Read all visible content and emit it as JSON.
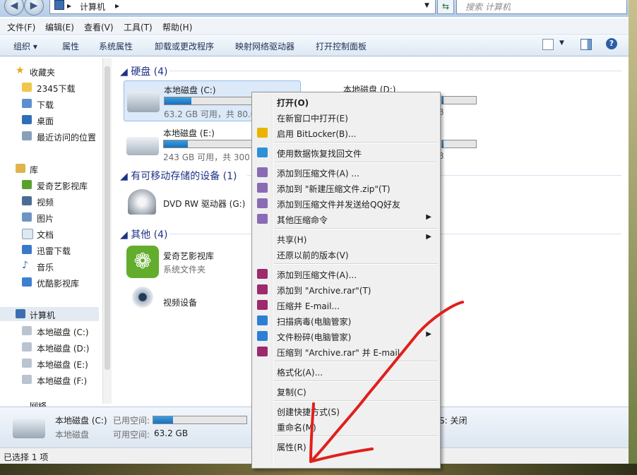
{
  "window": {
    "address": {
      "root_icon": "computer-icon",
      "path": "计算机",
      "sep": "▸"
    },
    "search_placeholder": "搜索 计算机"
  },
  "menubar": [
    "文件(F)",
    "编辑(E)",
    "查看(V)",
    "工具(T)",
    "帮助(H)"
  ],
  "toolbar": {
    "organize": "组织",
    "items": [
      "属性",
      "系统属性",
      "卸载或更改程序",
      "映射网络驱动器",
      "打开控制面板"
    ]
  },
  "nav": {
    "favorites": {
      "label": "收藏夹",
      "items": [
        "2345下载",
        "下载",
        "桌面",
        "最近访问的位置"
      ]
    },
    "libraries": {
      "label": "库",
      "items": [
        "爱奇艺影视库",
        "视频",
        "图片",
        "文档",
        "迅雷下载",
        "音乐",
        "优酷影视库"
      ]
    },
    "computer": {
      "label": "计算机",
      "items": [
        "本地磁盘 (C:)",
        "本地磁盘 (D:)",
        "本地磁盘 (E:)",
        "本地磁盘 (F:)"
      ]
    },
    "network": "网络"
  },
  "content": {
    "groups": [
      "硬盘 (4)",
      "有可移动存储的设备 (1)",
      "其他 (4)"
    ],
    "drives": [
      {
        "name": "本地磁盘 (C:)",
        "sub": "63.2 GB 可用，共 80.0",
        "used": 0.21
      },
      {
        "name": "本地磁盘 (D:)",
        "sub": "",
        "used": 0.05
      },
      {
        "name": "本地磁盘 (E:)",
        "sub": "243 GB 可用，共 300",
        "used": 0.19
      },
      {
        "name": "",
        "sub": "",
        "used": 0.04
      }
    ],
    "removable": [
      {
        "name": "DVD RW 驱动器 (G:)"
      }
    ],
    "other": [
      {
        "name": "爱奇艺影视库",
        "sub": "系统文件夹"
      },
      {
        "name": "视频设备",
        "sub": ""
      }
    ],
    "d_suffix": "3",
    "f_suffix": "3"
  },
  "details": {
    "name": "本地磁盘 (C:)",
    "type": "本地磁盘",
    "used_label": "已用空间:",
    "free_label": "可用空间:",
    "free_value": "63.2 GB",
    "used": 0.21,
    "bitlocker_suffix": "S: 关闭"
  },
  "status": "已选择 1 项",
  "context_menu": [
    {
      "label": "打开(O)",
      "bold": true,
      "icon": ""
    },
    {
      "label": "在新窗口中打开(E)",
      "icon": ""
    },
    {
      "label": "启用 BitLocker(B)...",
      "icon": "shield-icon"
    },
    {
      "sep": true
    },
    {
      "label": "使用数据恢复找回文件",
      "icon": "recovery-icon"
    },
    {
      "sep": true
    },
    {
      "label": "添加到压缩文件(A) ...",
      "icon": "zip-icon"
    },
    {
      "label": "添加到 \"新建压缩文件.zip\"(T)",
      "icon": "zip-icon"
    },
    {
      "label": "添加到压缩文件并发送给QQ好友",
      "icon": "zip-icon"
    },
    {
      "label": "其他压缩命令",
      "icon": "zip-icon",
      "arrow": true
    },
    {
      "sep": true
    },
    {
      "label": "共享(H)",
      "icon": "",
      "arrow": true
    },
    {
      "label": "还原以前的版本(V)",
      "icon": ""
    },
    {
      "sep": true
    },
    {
      "label": "添加到压缩文件(A)...",
      "icon": "rar-icon"
    },
    {
      "label": "添加到 \"Archive.rar\"(T)",
      "icon": "rar-icon"
    },
    {
      "label": "压缩并 E-mail...",
      "icon": "rar-icon"
    },
    {
      "label": "扫描病毒(电脑管家)",
      "icon": "guard-icon"
    },
    {
      "label": "文件粉碎(电脑管家)",
      "icon": "guard-icon",
      "arrow": true
    },
    {
      "label": "压缩到 \"Archive.rar\" 并 E-mail",
      "icon": "rar-icon"
    },
    {
      "sep": true
    },
    {
      "label": "格式化(A)...",
      "icon": ""
    },
    {
      "sep": true
    },
    {
      "label": "复制(C)",
      "icon": ""
    },
    {
      "sep": true
    },
    {
      "label": "创建快捷方式(S)",
      "icon": ""
    },
    {
      "label": "重命名(M)",
      "icon": ""
    },
    {
      "sep": true
    },
    {
      "label": "属性(R)",
      "icon": ""
    }
  ],
  "colors": {
    "annotation": "#e0201c",
    "accent": "#1e3287",
    "bar": "#2a86d0"
  }
}
